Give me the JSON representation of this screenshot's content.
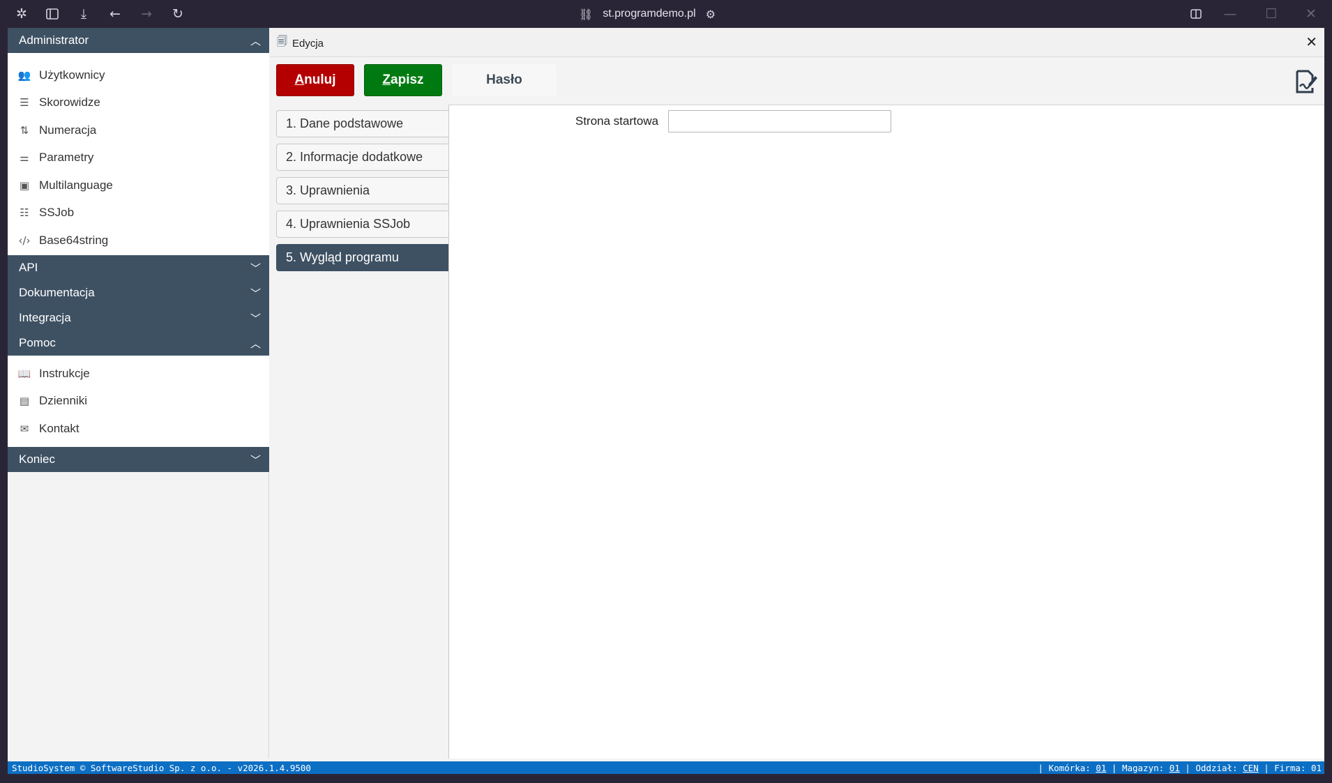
{
  "browser": {
    "url": "st.programdemo.pl",
    "icons": [
      "app-logo-icon",
      "sidebar-toggle-icon",
      "download-icon",
      "back-icon",
      "forward-icon",
      "reload-icon",
      "link-icon",
      "site-settings-icon",
      "split-view-icon",
      "minimize-icon",
      "maximize-icon",
      "close-window-icon"
    ]
  },
  "sidebar": {
    "administrator": {
      "title": "Administrator",
      "items": [
        {
          "label": "Użytkownicy",
          "icon": "users-icon"
        },
        {
          "label": "Skorowidze",
          "icon": "list-icon"
        },
        {
          "label": "Numeracja",
          "icon": "numbering-icon"
        },
        {
          "label": "Parametry",
          "icon": "sliders-icon"
        },
        {
          "label": "Multilanguage",
          "icon": "language-icon"
        },
        {
          "label": "SSJob",
          "icon": "tasks-icon"
        },
        {
          "label": "Base64string",
          "icon": "code-icon"
        }
      ]
    },
    "api": {
      "title": "API"
    },
    "dokumentacja": {
      "title": "Dokumentacja"
    },
    "integracja": {
      "title": "Integracja"
    },
    "pomoc": {
      "title": "Pomoc",
      "items": [
        {
          "label": "Instrukcje",
          "icon": "book-icon"
        },
        {
          "label": "Dzienniki",
          "icon": "journal-icon"
        },
        {
          "label": "Kontakt",
          "icon": "contact-icon"
        }
      ]
    },
    "koniec": {
      "title": "Koniec"
    }
  },
  "main": {
    "title": "Edycja",
    "buttons": {
      "anuluj_first": "A",
      "anuluj_rest": "nuluj",
      "zapisz_first": "Z",
      "zapisz_rest": "apisz",
      "haslo": "Hasło"
    },
    "tabs": [
      "1. Dane podstawowe",
      "2. Informacje dodatkowe",
      "3. Uprawnienia",
      "4. Uprawnienia SSJob",
      "5. Wygląd programu"
    ],
    "active_tab": "5. Wygląd programu",
    "form": {
      "strona_startowa_label": "Strona startowa",
      "strona_startowa_value": ""
    }
  },
  "status": {
    "left": "StudioSystem © SoftwareStudio Sp. z o.o. - v2026.1.4.9500",
    "komorka_label": "Komórka:",
    "komorka_value": "01",
    "magazyn_label": "Magazyn:",
    "magazyn_value": "01",
    "oddzial_label": "Oddział:",
    "oddzial_value": "CEN",
    "firma_label": "Firma:",
    "firma_value": "01"
  },
  "colors": {
    "section_header": "#3e5163",
    "cancel": "#b40000",
    "save": "#007a10",
    "statusbar": "#0c6fc4"
  }
}
